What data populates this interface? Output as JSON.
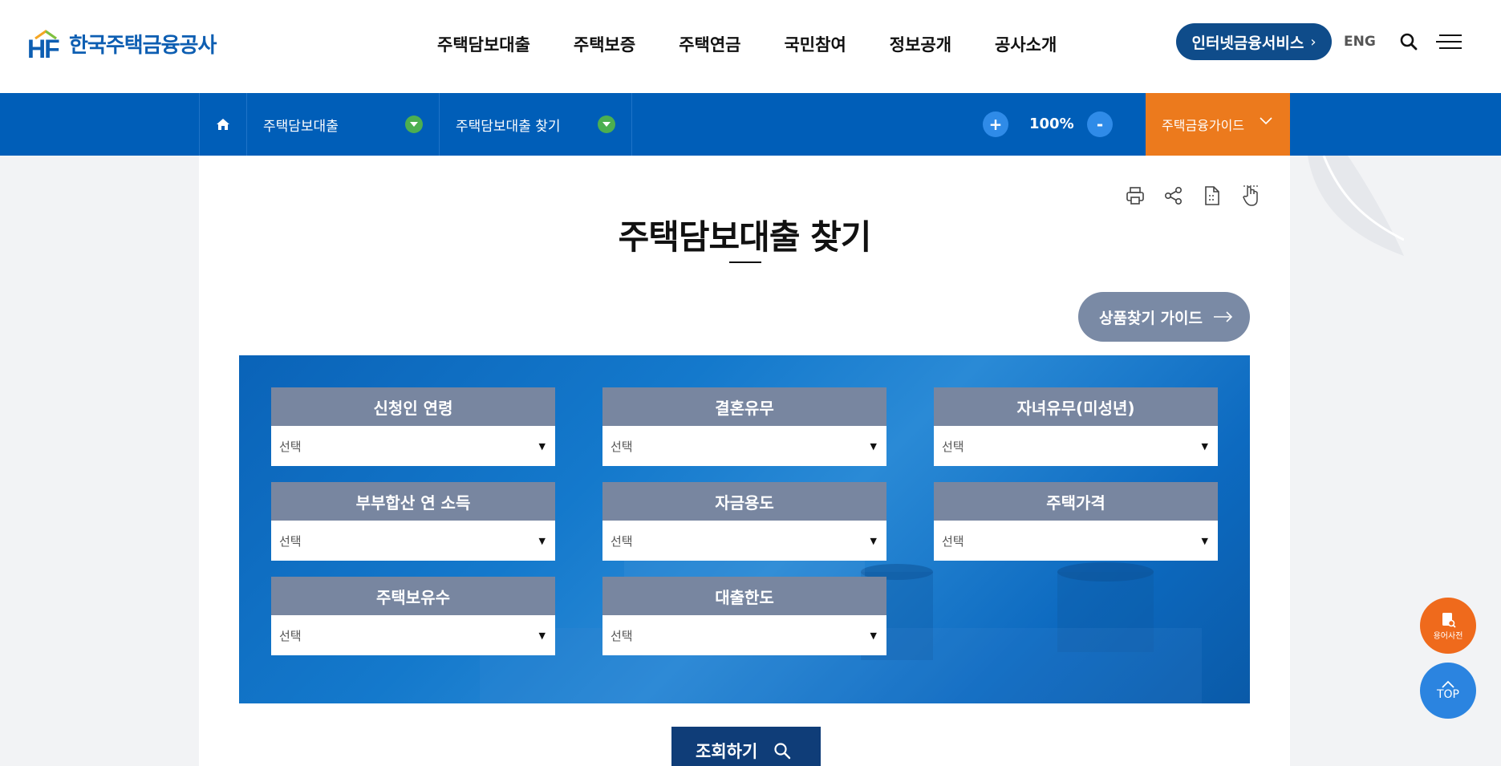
{
  "header": {
    "logo_text": "한국주택금융공사",
    "logo_mark": "HF",
    "nav": [
      "주택담보대출",
      "주택보증",
      "주택연금",
      "국민참여",
      "정보공개",
      "공사소개"
    ],
    "internet_button": "인터넷금융서비스",
    "lang": "ENG"
  },
  "subnav": {
    "crumb1": "주택담보대출",
    "crumb2": "주택담보대출 찾기",
    "zoom_plus": "+",
    "zoom_value": "100%",
    "zoom_minus": "-",
    "guide_label": "주택금융가이드"
  },
  "main": {
    "title": "주택담보대출 찾기",
    "guide_button": "상품찾기 가이드",
    "filters": [
      {
        "label": "신청인 연령",
        "value": "선택"
      },
      {
        "label": "결혼유무",
        "value": "선택"
      },
      {
        "label": "자녀유무(미성년)",
        "value": "선택"
      },
      {
        "label": "부부합산 연 소득",
        "value": "선택"
      },
      {
        "label": "자금용도",
        "value": "선택"
      },
      {
        "label": "주택가격",
        "value": "선택"
      },
      {
        "label": "주택보유수",
        "value": "선택"
      },
      {
        "label": "대출한도",
        "value": "선택"
      }
    ],
    "search_button": "조회하기"
  },
  "floating": {
    "dict_label": "용어사전",
    "top_label": "TOP"
  },
  "colors": {
    "brand_blue": "#005eb8",
    "accent_orange": "#ec7a1d",
    "navy": "#0f4c8a",
    "label_gray": "#7886a0"
  }
}
